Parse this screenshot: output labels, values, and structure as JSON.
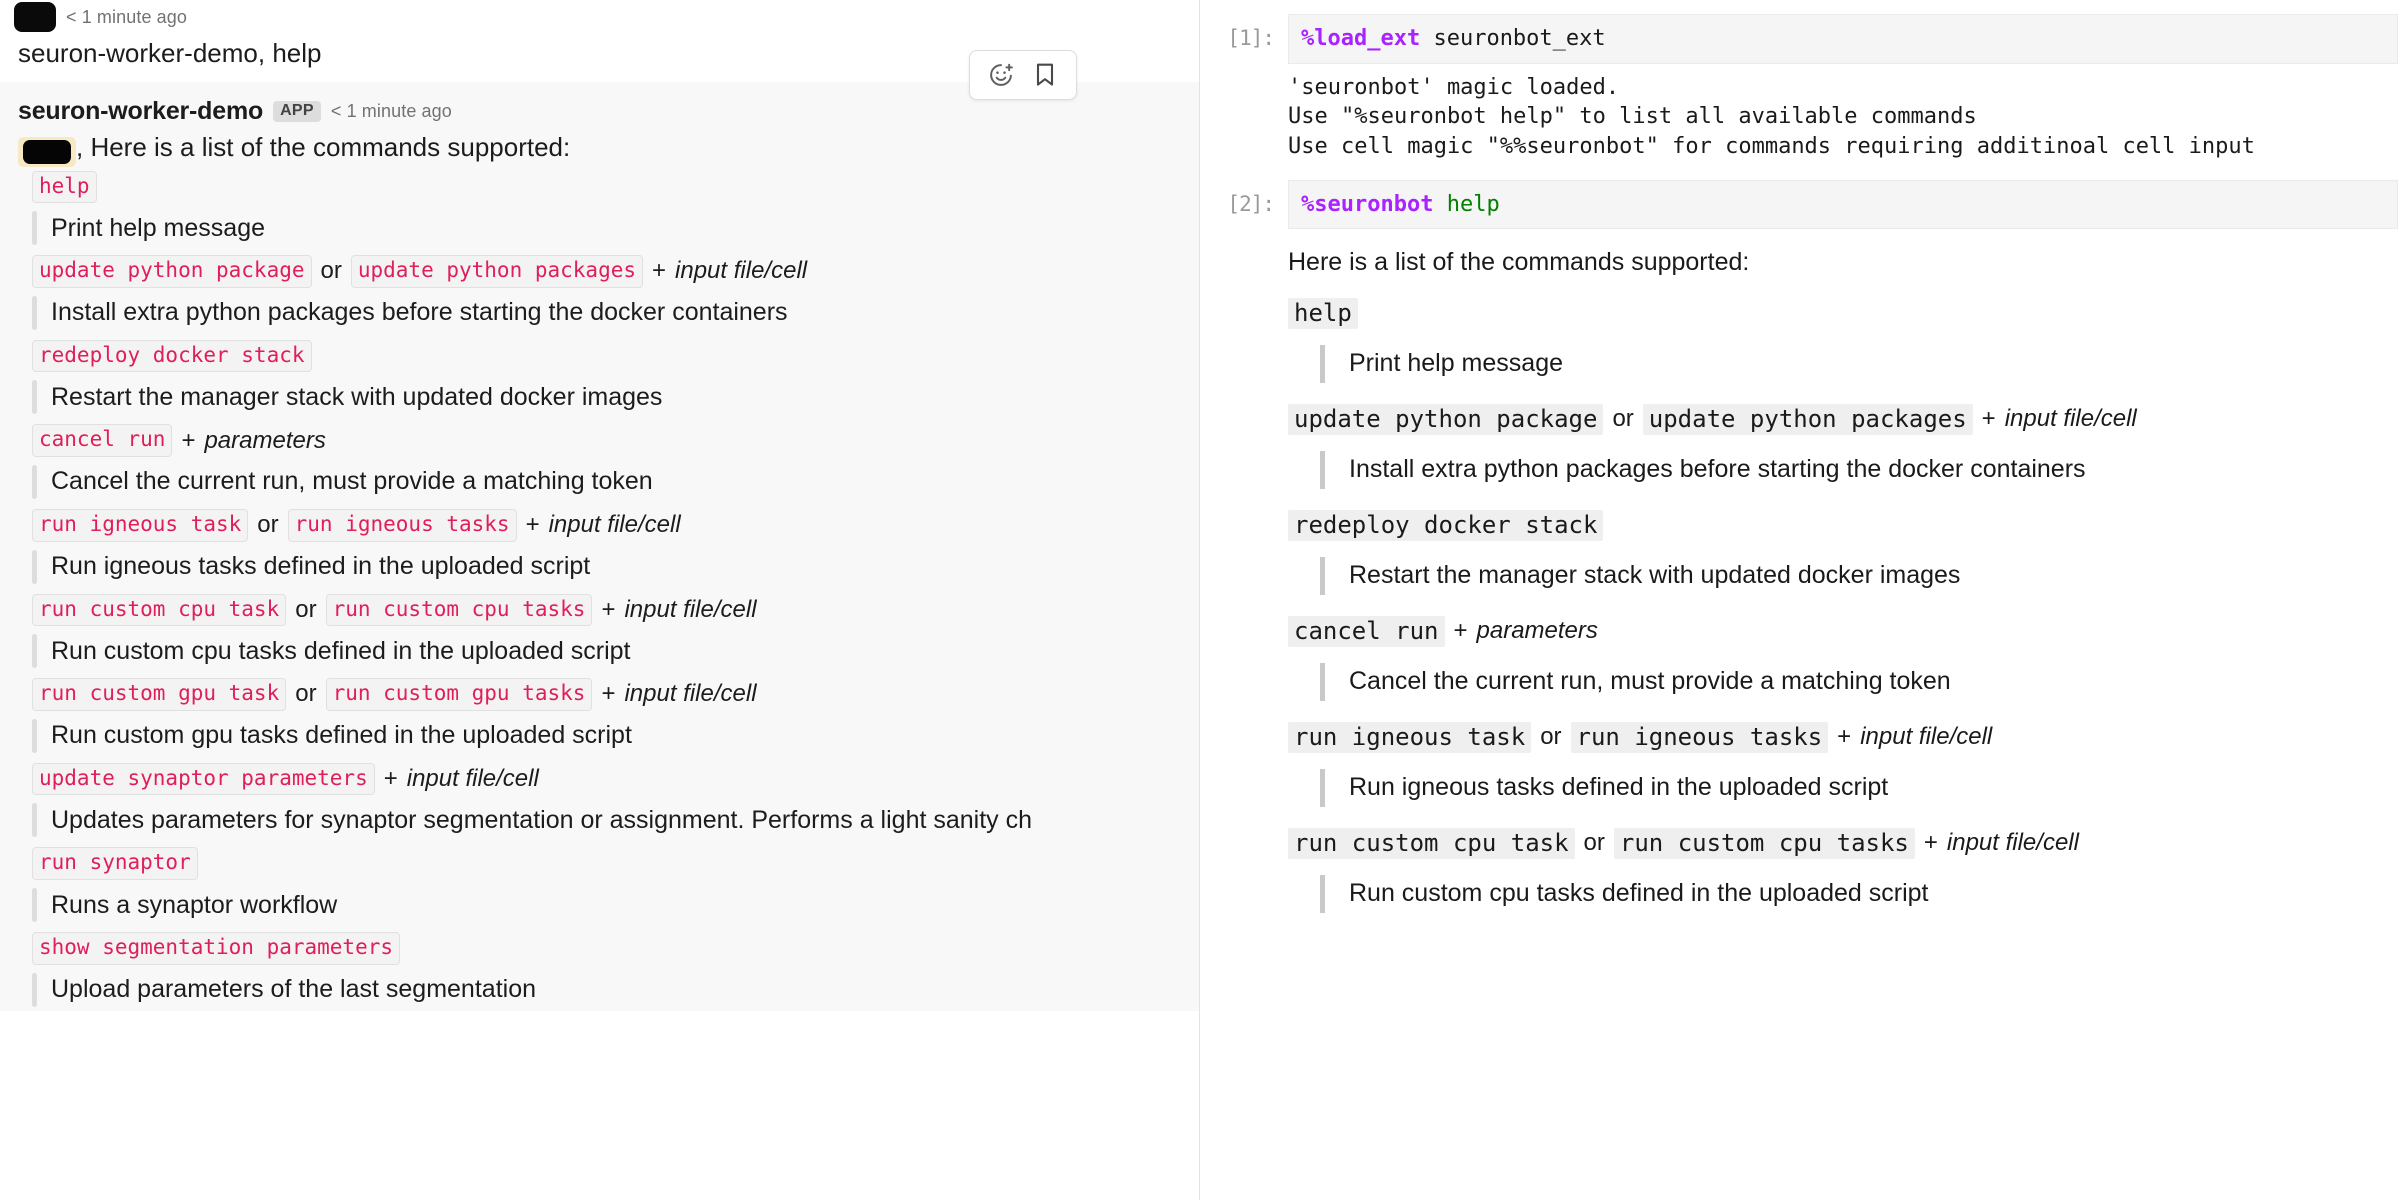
{
  "slack": {
    "user_message": {
      "timestamp": "< 1 minute ago",
      "text": "seuron-worker-demo, help"
    },
    "bot_message": {
      "author": "seuron-worker-demo",
      "app_badge": "APP",
      "timestamp": "< 1 minute ago",
      "intro_suffix": ", Here is a list of the commands supported:",
      "entries": [
        {
          "codes": [
            "help"
          ],
          "separator": "",
          "suffix_plus": "",
          "suffix_italic": "",
          "description": "Print help message"
        },
        {
          "codes": [
            "update python package",
            "update python packages"
          ],
          "separator": "or",
          "suffix_plus": "+",
          "suffix_italic": "input file/cell",
          "description": "Install extra python packages before starting the docker containers"
        },
        {
          "codes": [
            "redeploy docker stack"
          ],
          "separator": "",
          "suffix_plus": "",
          "suffix_italic": "",
          "description": "Restart the manager stack with updated docker images"
        },
        {
          "codes": [
            "cancel run"
          ],
          "separator": "",
          "suffix_plus": "+",
          "suffix_italic": "parameters",
          "description": "Cancel the current run, must provide a matching token"
        },
        {
          "codes": [
            "run igneous task",
            "run igneous tasks"
          ],
          "separator": "or",
          "suffix_plus": "+",
          "suffix_italic": "input file/cell",
          "description": "Run igneous tasks defined in the uploaded script"
        },
        {
          "codes": [
            "run custom cpu task",
            "run custom cpu tasks"
          ],
          "separator": "or",
          "suffix_plus": "+",
          "suffix_italic": "input file/cell",
          "description": "Run custom cpu tasks defined in the uploaded script"
        },
        {
          "codes": [
            "run custom gpu task",
            "run custom gpu tasks"
          ],
          "separator": "or",
          "suffix_plus": "+",
          "suffix_italic": "input file/cell",
          "description": "Run custom gpu tasks defined in the uploaded script"
        },
        {
          "codes": [
            "update synaptor parameters"
          ],
          "separator": "",
          "suffix_plus": "+",
          "suffix_italic": "input file/cell",
          "description": "Updates parameters for synaptor segmentation or assignment. Performs a light sanity ch"
        },
        {
          "codes": [
            "run synaptor"
          ],
          "separator": "",
          "suffix_plus": "",
          "suffix_italic": "",
          "description": "Runs a synaptor workflow"
        },
        {
          "codes": [
            "show segmentation parameters"
          ],
          "separator": "",
          "suffix_plus": "",
          "suffix_italic": "",
          "description": "Upload parameters of the last segmentation"
        }
      ]
    },
    "hover_toolbar": {
      "add_reaction_label": "add-reaction",
      "save_label": "save-for-later"
    }
  },
  "notebook": {
    "cells": [
      {
        "prompt": "[1]:",
        "code_magic": "%load_ext",
        "code_rest": " seuronbot_ext",
        "output_lines": [
          "'seuronbot' magic loaded.",
          "Use \"%seuronbot help\" to list all available commands",
          "Use cell magic \"%%seuronbot\" for commands requiring additinoal cell input"
        ]
      },
      {
        "prompt": "[2]:",
        "code_magic": "%seuronbot",
        "code_arg": "help",
        "markdown_intro": "Here is a list of the commands supported:",
        "entries": [
          {
            "codes": [
              "help"
            ],
            "separator": "",
            "suffix_plus": "",
            "suffix_italic": "",
            "description": "Print help message"
          },
          {
            "codes": [
              "update python package",
              "update python packages"
            ],
            "separator": "or",
            "suffix_plus": "+",
            "suffix_italic": "input file/cell",
            "description": "Install extra python packages before starting the docker containers"
          },
          {
            "codes": [
              "redeploy docker stack"
            ],
            "separator": "",
            "suffix_plus": "",
            "suffix_italic": "",
            "description": "Restart the manager stack with updated docker images"
          },
          {
            "codes": [
              "cancel run"
            ],
            "separator": "",
            "suffix_plus": "+",
            "suffix_italic": "parameters",
            "description": "Cancel the current run, must provide a matching token"
          },
          {
            "codes": [
              "run igneous task",
              "run igneous tasks"
            ],
            "separator": "or",
            "suffix_plus": "+",
            "suffix_italic": "input file/cell",
            "description": "Run igneous tasks defined in the uploaded script"
          },
          {
            "codes": [
              "run custom cpu task",
              "run custom cpu tasks"
            ],
            "separator": "or",
            "suffix_plus": "+",
            "suffix_italic": "input file/cell",
            "description": "Run custom cpu tasks defined in the uploaded script"
          }
        ]
      }
    ]
  },
  "colors": {
    "slack_code_text": "#e01e5a",
    "slack_code_bg": "#f3f3f3",
    "mention_bg": "#f7e9c4",
    "jupyter_input_bg": "#f5f5f5",
    "jupyter_code_bg": "#efefef",
    "magic_token": "#aa22ff",
    "string_token": "#008000",
    "prompt_text": "#9a9a9a"
  }
}
